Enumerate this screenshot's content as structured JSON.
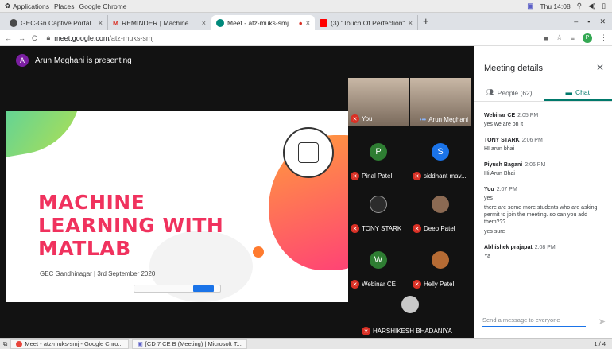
{
  "os_bar": {
    "applications": "Applications",
    "places": "Places",
    "active_app": "Google Chrome",
    "clock": "Thu 14:08"
  },
  "browser": {
    "tabs": [
      {
        "label": "GEC-Gn Captive Portal",
        "favicon_color": "#4a4a4a"
      },
      {
        "label": "REMINDER | Machine Lea",
        "favicon_color": "#d93025"
      },
      {
        "label": "Meet - atz-muks-smj",
        "favicon_color": "#00897b"
      },
      {
        "label": "(3) \"Touch Of Perfection\"",
        "favicon_color": "#ff0000"
      }
    ],
    "address_host": "meet.google.com",
    "address_path": "/atz-muks-smj",
    "profile_initial": "P"
  },
  "meet": {
    "presenter_initial": "A",
    "presenting_text": "Arun Meghani is presenting",
    "slide": {
      "title_lines": [
        "MACHINE",
        "LEARNING WITH",
        "MATLAB"
      ],
      "subtitle": "GEC Gandhinagar | 3rd September 2020"
    },
    "participants": [
      {
        "name": "You",
        "kind": "video"
      },
      {
        "name": "Arun Meghani",
        "kind": "video"
      },
      {
        "name": "Pinal Patel",
        "kind": "initial",
        "initial": "P",
        "color": "#2e7d32"
      },
      {
        "name": "siddhant mav...",
        "kind": "initial",
        "initial": "S",
        "color": "#1a73e8"
      },
      {
        "name": "TONY STARK",
        "kind": "photo",
        "color": "#2c2c2c"
      },
      {
        "name": "Deep Patel",
        "kind": "photo",
        "color": "#8b6a53"
      },
      {
        "name": "Webinar CE",
        "kind": "initial",
        "initial": "W",
        "color": "#2e7d32"
      },
      {
        "name": "Helly Patel",
        "kind": "photo",
        "color": "#b56b34"
      },
      {
        "name": "HARSHIKESH BHADANIYA",
        "kind": "photo",
        "color": "#c9c9c9"
      }
    ]
  },
  "panel": {
    "title": "Meeting details",
    "tabs": [
      {
        "label": "People (62)",
        "active": false
      },
      {
        "label": "Chat",
        "active": true
      }
    ],
    "messages": [
      {
        "sender": "Webinar CE",
        "time": "2:05 PM",
        "lines": [
          "yes we are on it"
        ]
      },
      {
        "sender": "TONY STARK",
        "time": "2:06 PM",
        "lines": [
          "HI arun bhai"
        ]
      },
      {
        "sender": "Piyush Bagani",
        "time": "2:06 PM",
        "lines": [
          "Hi Arun Bhai"
        ]
      },
      {
        "sender": "You",
        "time": "2:07 PM",
        "lines": [
          "yes",
          "there are some more students who are asking permit to join the meeting. so can you add them???",
          "yes sure"
        ]
      },
      {
        "sender": "Abhishek prajapat",
        "time": "2:08 PM",
        "lines": [
          "Ya"
        ]
      }
    ],
    "input_placeholder": "Send a message to everyone"
  },
  "taskbar": {
    "items": [
      {
        "label": "Meet - atz-muks-smj - Google Chro..."
      },
      {
        "label": "[CD 7 CE B (Meeting) | Microsoft T..."
      }
    ],
    "workspace": "1 / 4"
  }
}
